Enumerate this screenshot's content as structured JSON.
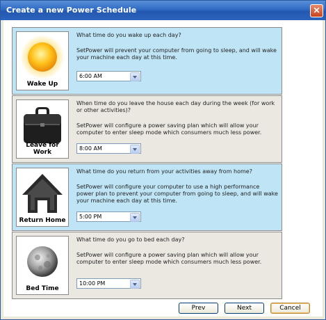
{
  "window": {
    "title": "Create a new Power Schedule"
  },
  "sections": [
    {
      "caption": "Wake Up",
      "question": "What time do you wake up each day?",
      "description": "SetPower will prevent your computer from going to sleep, and will wake your machine each day at this time.",
      "time": "6:00 AM"
    },
    {
      "caption": "Leave for Work",
      "question": "When time do you leave the house each day during the week (for work or other activities)?",
      "description": "SetPower will configure a power saving plan which will allow your computer to enter sleep mode which consumers much less power.",
      "time": "8:00 AM"
    },
    {
      "caption": "Return Home",
      "question": "What time do you return from your activities away from home?",
      "description": "SetPower will configure your computer to use a high performance power plan to prevent your computer from going to sleep, and will wake your machine each day at this time.",
      "time": "5:00 PM"
    },
    {
      "caption": "Bed Time",
      "question": "What time do you go to bed each day?",
      "description": "SetPower will configure a power saving plan which will allow your computer to enter sleep mode which consumers much less power.",
      "time": "10:00 PM"
    }
  ],
  "buttons": {
    "prev": "Prev",
    "next": "Next",
    "cancel": "Cancel"
  },
  "icons": [
    "sun-icon",
    "briefcase-icon",
    "house-icon",
    "moon-icon",
    "close-icon",
    "chevron-down-icon"
  ]
}
